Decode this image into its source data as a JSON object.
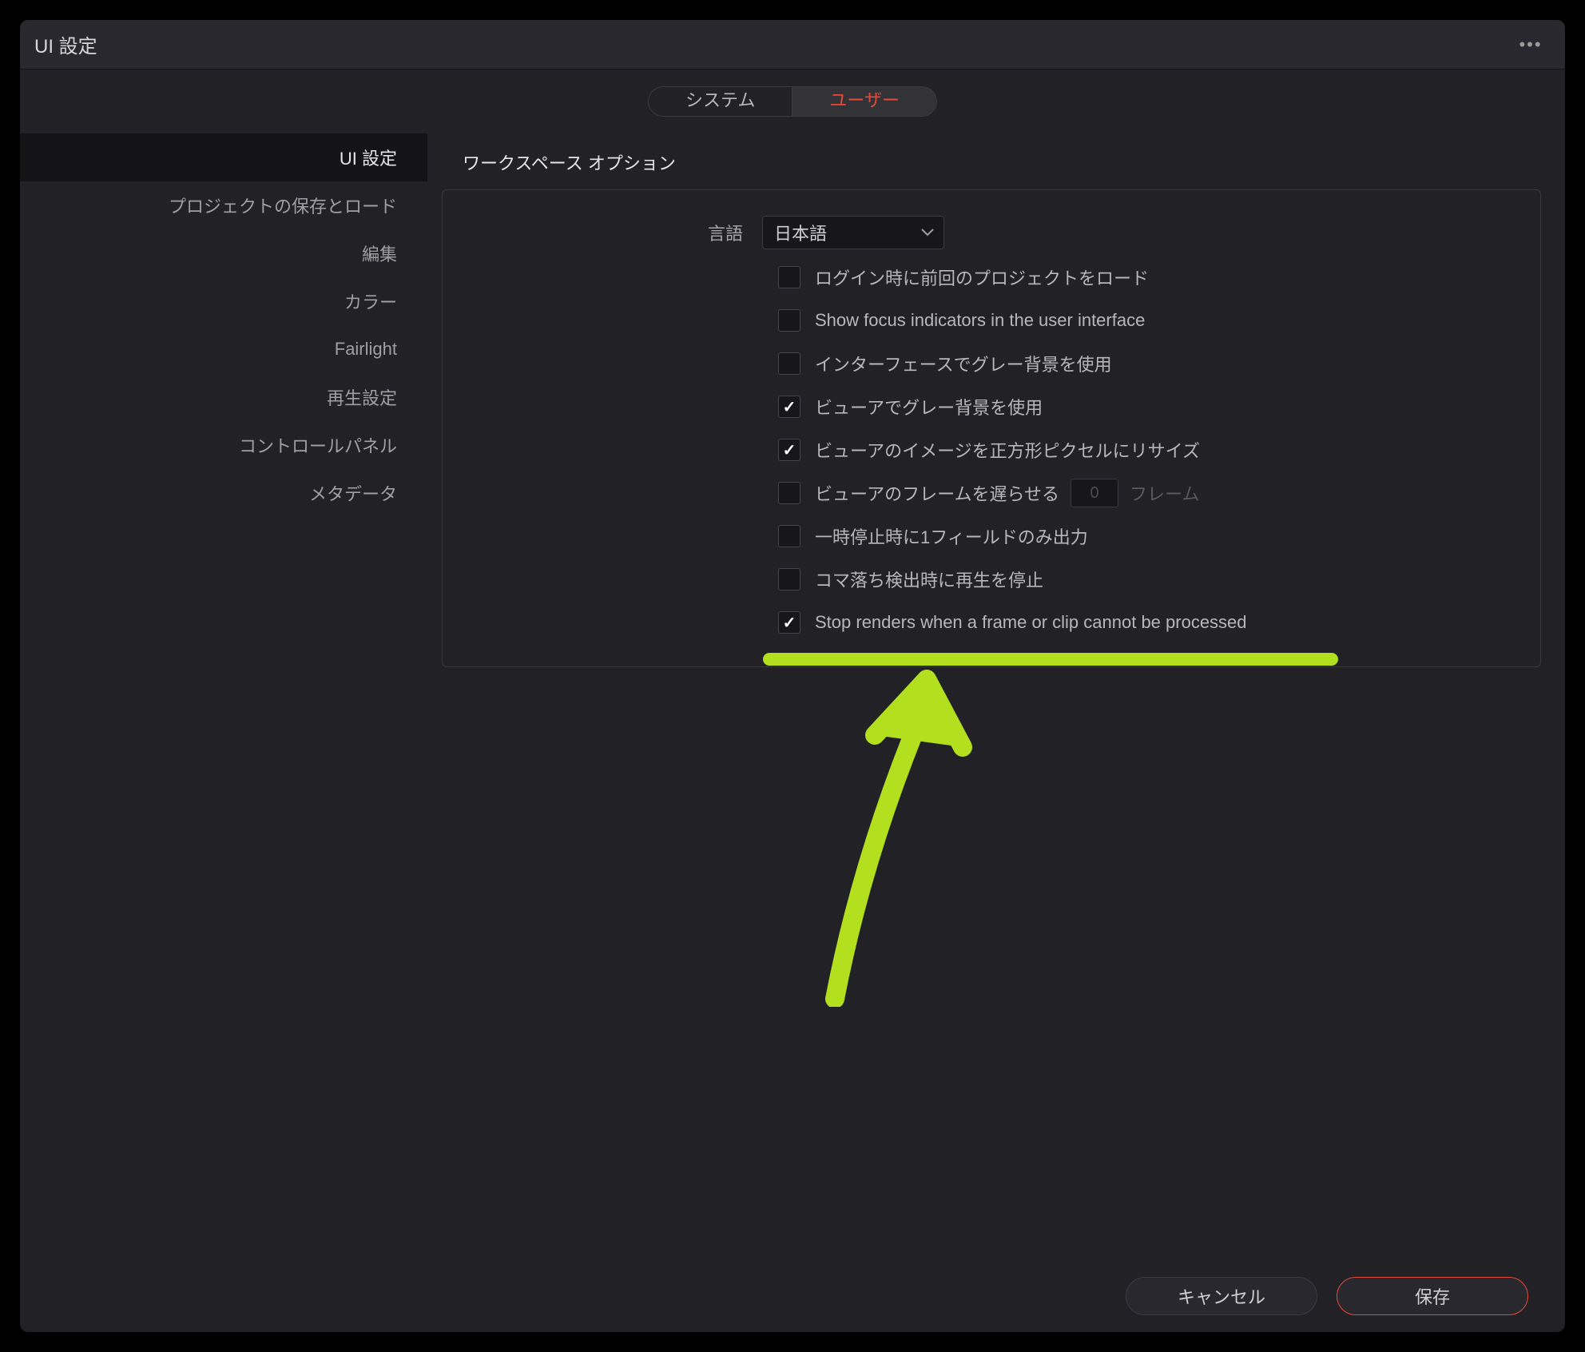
{
  "title": "UI 設定",
  "tabs": {
    "system": "システム",
    "user": "ユーザー"
  },
  "sidebar": {
    "items": [
      "UI 設定",
      "プロジェクトの保存とロード",
      "編集",
      "カラー",
      "Fairlight",
      "再生設定",
      "コントロールパネル",
      "メタデータ"
    ]
  },
  "section_title": "ワークスペース オプション",
  "lang_label": "言語",
  "lang_value": "日本語",
  "options": [
    {
      "label": "ログイン時に前回のプロジェクトをロード",
      "checked": false
    },
    {
      "label": "Show focus indicators in the user interface",
      "checked": false
    },
    {
      "label": "インターフェースでグレー背景を使用",
      "checked": false
    },
    {
      "label": "ビューアでグレー背景を使用",
      "checked": true
    },
    {
      "label": "ビューアのイメージを正方形ピクセルにリサイズ",
      "checked": true
    },
    {
      "label": "ビューアのフレームを遅らせる",
      "checked": false,
      "num": "0",
      "unit": "フレーム"
    },
    {
      "label": "一時停止時に1フィールドのみ出力",
      "checked": false
    },
    {
      "label": "コマ落ち検出時に再生を停止",
      "checked": false
    },
    {
      "label": "Stop renders when a frame or clip cannot be processed",
      "checked": true
    }
  ],
  "footer": {
    "cancel": "キャンセル",
    "save": "保存"
  }
}
